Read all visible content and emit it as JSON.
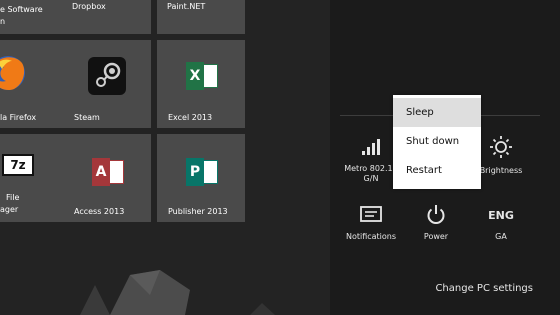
{
  "tiles": [
    {
      "label": "e Software",
      "label2": "n"
    },
    {
      "label": "Dropbox"
    },
    {
      "label": "Paint.NET"
    },
    {
      "label": "la Firefox"
    },
    {
      "label": "Steam"
    },
    {
      "label": "Excel 2013"
    },
    {
      "label": "File",
      "label2": "ager"
    },
    {
      "label": "Access 2013"
    },
    {
      "label": "Publisher 2013"
    }
  ],
  "settings": {
    "network_label": "Metro 802.11",
    "network_sub": "G/N",
    "brightness_label": "Brightness",
    "notifications_label": "Notifications",
    "power_label": "Power",
    "language_label": "ENG",
    "language_sub": "GA",
    "change_pc_settings": "Change PC settings"
  },
  "power_menu": {
    "items": [
      "Sleep",
      "Shut down",
      "Restart"
    ],
    "selected": "Sleep"
  },
  "icons": {
    "excel_letter": "X",
    "access_letter": "A",
    "publisher_letter": "P",
    "sevenzip_text": "7z"
  },
  "colors": {
    "excel": "#217346",
    "access": "#a4373a",
    "publisher": "#077568",
    "tile_bg": "#4a4a4a"
  }
}
